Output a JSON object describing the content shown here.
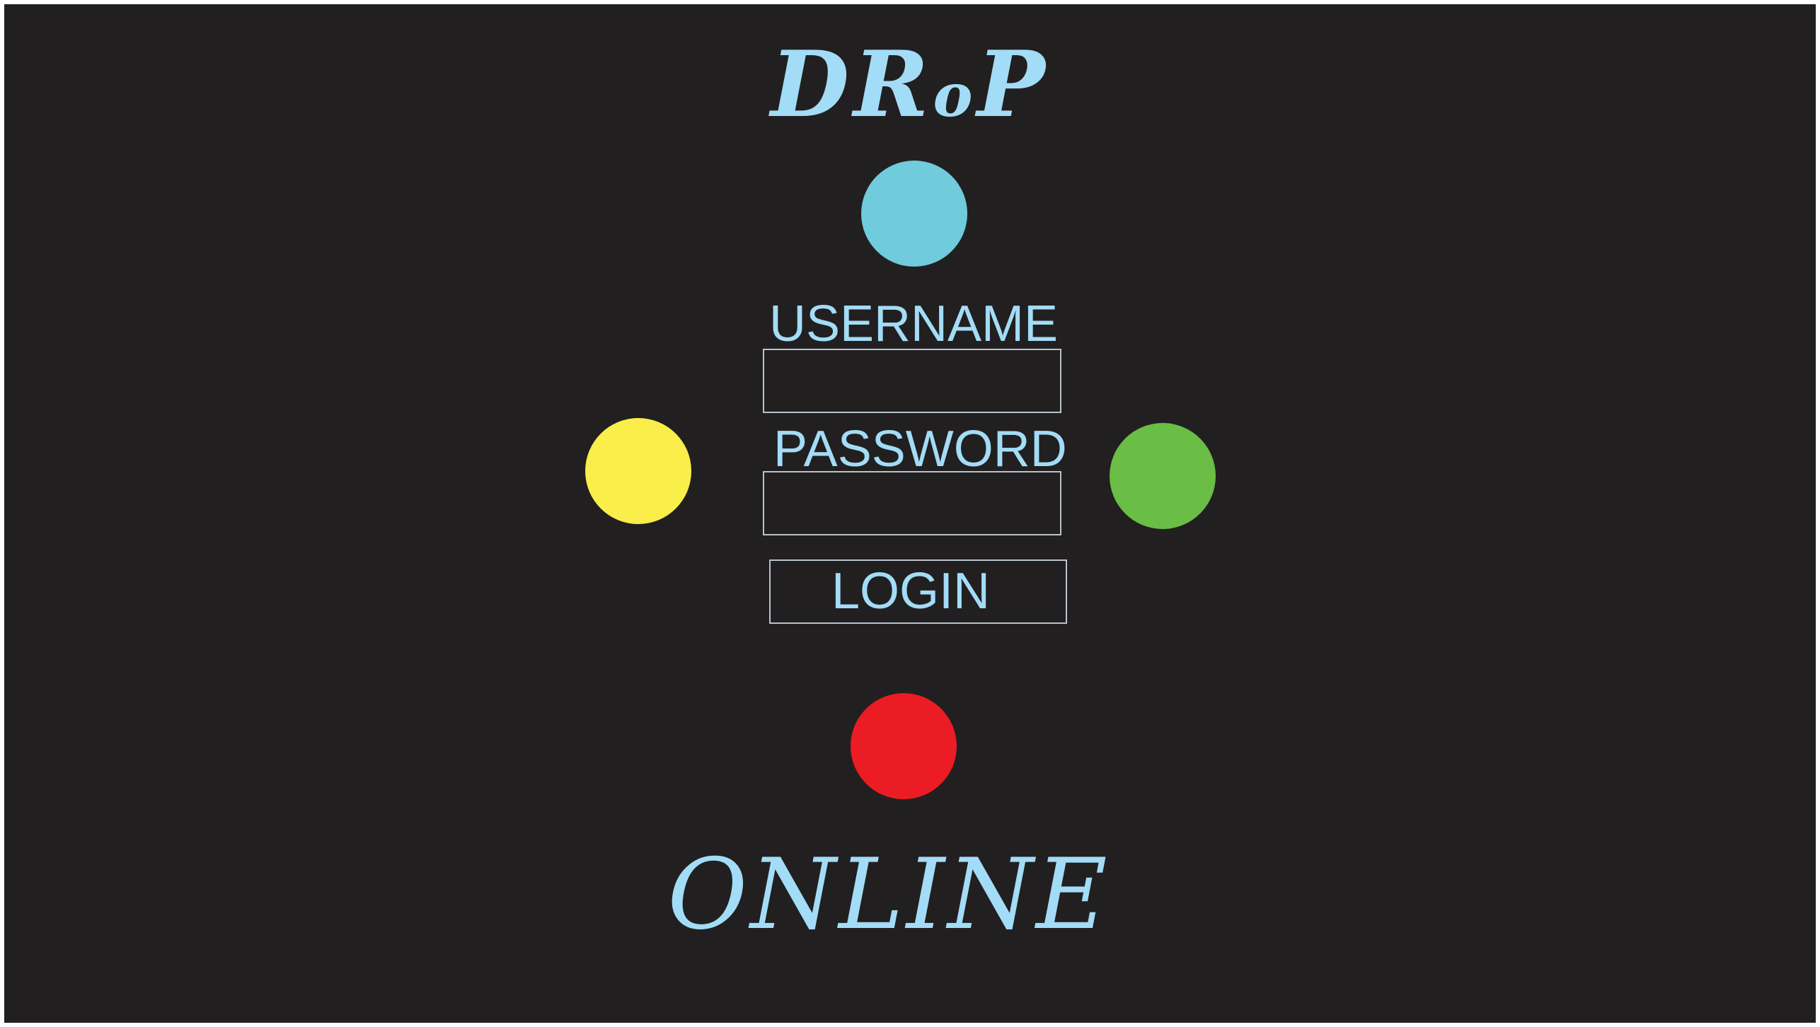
{
  "app": {
    "title_prefix": "DR",
    "title_middle": "o",
    "title_suffix": "P",
    "subtitle": "ONLINE"
  },
  "login": {
    "username_label": "USERNAME",
    "username_value": "",
    "password_label": "PASSWORD",
    "password_value": "",
    "login_label": "LOGIN"
  },
  "colors": {
    "background": "#221f20",
    "text_accent": "#a3dcf6",
    "dot_blue": "#70cbdc",
    "dot_yellow": "#f9ee4a",
    "dot_green": "#6abd45",
    "dot_red": "#ec1c24"
  }
}
